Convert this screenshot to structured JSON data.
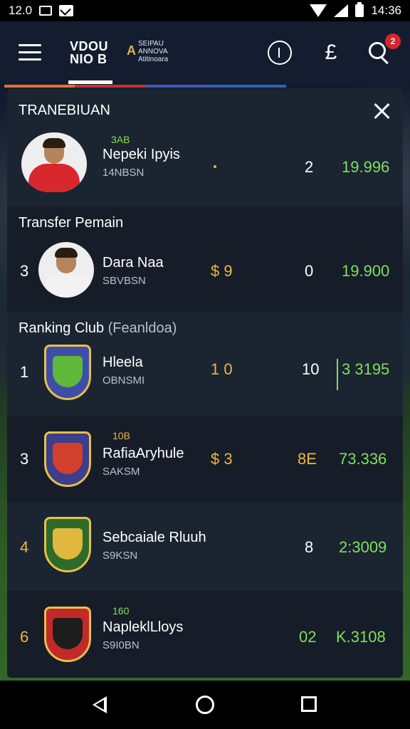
{
  "status_bar": {
    "left_text": "12.0",
    "time": "14:36"
  },
  "header": {
    "logo_line1": "VDOU",
    "logo_line2": "NIO B",
    "logo2_letter": "A",
    "logo2_line1": "SEIPAU",
    "logo2_line2": "ANNOVA",
    "logo2_line3": "Atitinoara",
    "notification_count": "2"
  },
  "accent_colors": {
    "strip": [
      "#e8702a",
      "#c7312f",
      "#3f57b6",
      "#2a62b8"
    ]
  },
  "panel": {
    "section1": {
      "title": "TRANEBIUAN",
      "rows": [
        {
          "rank": "",
          "tag": "3AB",
          "name": "Nepeki Ipyis",
          "sub": "14NBSN",
          "col1": "",
          "col2": "2",
          "col3": "19.996"
        }
      ]
    },
    "section2": {
      "title": "Transfer Pemain",
      "rows": [
        {
          "rank": "3",
          "tag": "",
          "name": "Dara Naa",
          "sub": "SBVBSN",
          "col1": "$ 9",
          "col2": "0",
          "col3": "19.900"
        }
      ]
    },
    "section3": {
      "title": "Ranking Club",
      "subtitle": "(Feanldoa)",
      "rows": [
        {
          "rank": "1",
          "tag": "",
          "name": "Hleela",
          "sub": "OBNSMI",
          "col1": "1 0",
          "col2": "10",
          "col3": "3 3195"
        },
        {
          "rank": "3",
          "tag": "10B",
          "name": "RafiaAryhule",
          "sub": "SAKSM",
          "col1": "$ 3",
          "col2": "8E",
          "col3": "73.336"
        },
        {
          "rank": "4",
          "tag": "",
          "name": "Sebcaiale Rluuh",
          "sub": "S9KSN",
          "col1": "",
          "col2": "8",
          "col3": "2:3009"
        },
        {
          "rank": "6",
          "tag": "160",
          "name": "NapleklLloys",
          "sub": "S9I0BN",
          "col1": "",
          "col2": "02",
          "col3": "K.3108"
        }
      ]
    }
  }
}
